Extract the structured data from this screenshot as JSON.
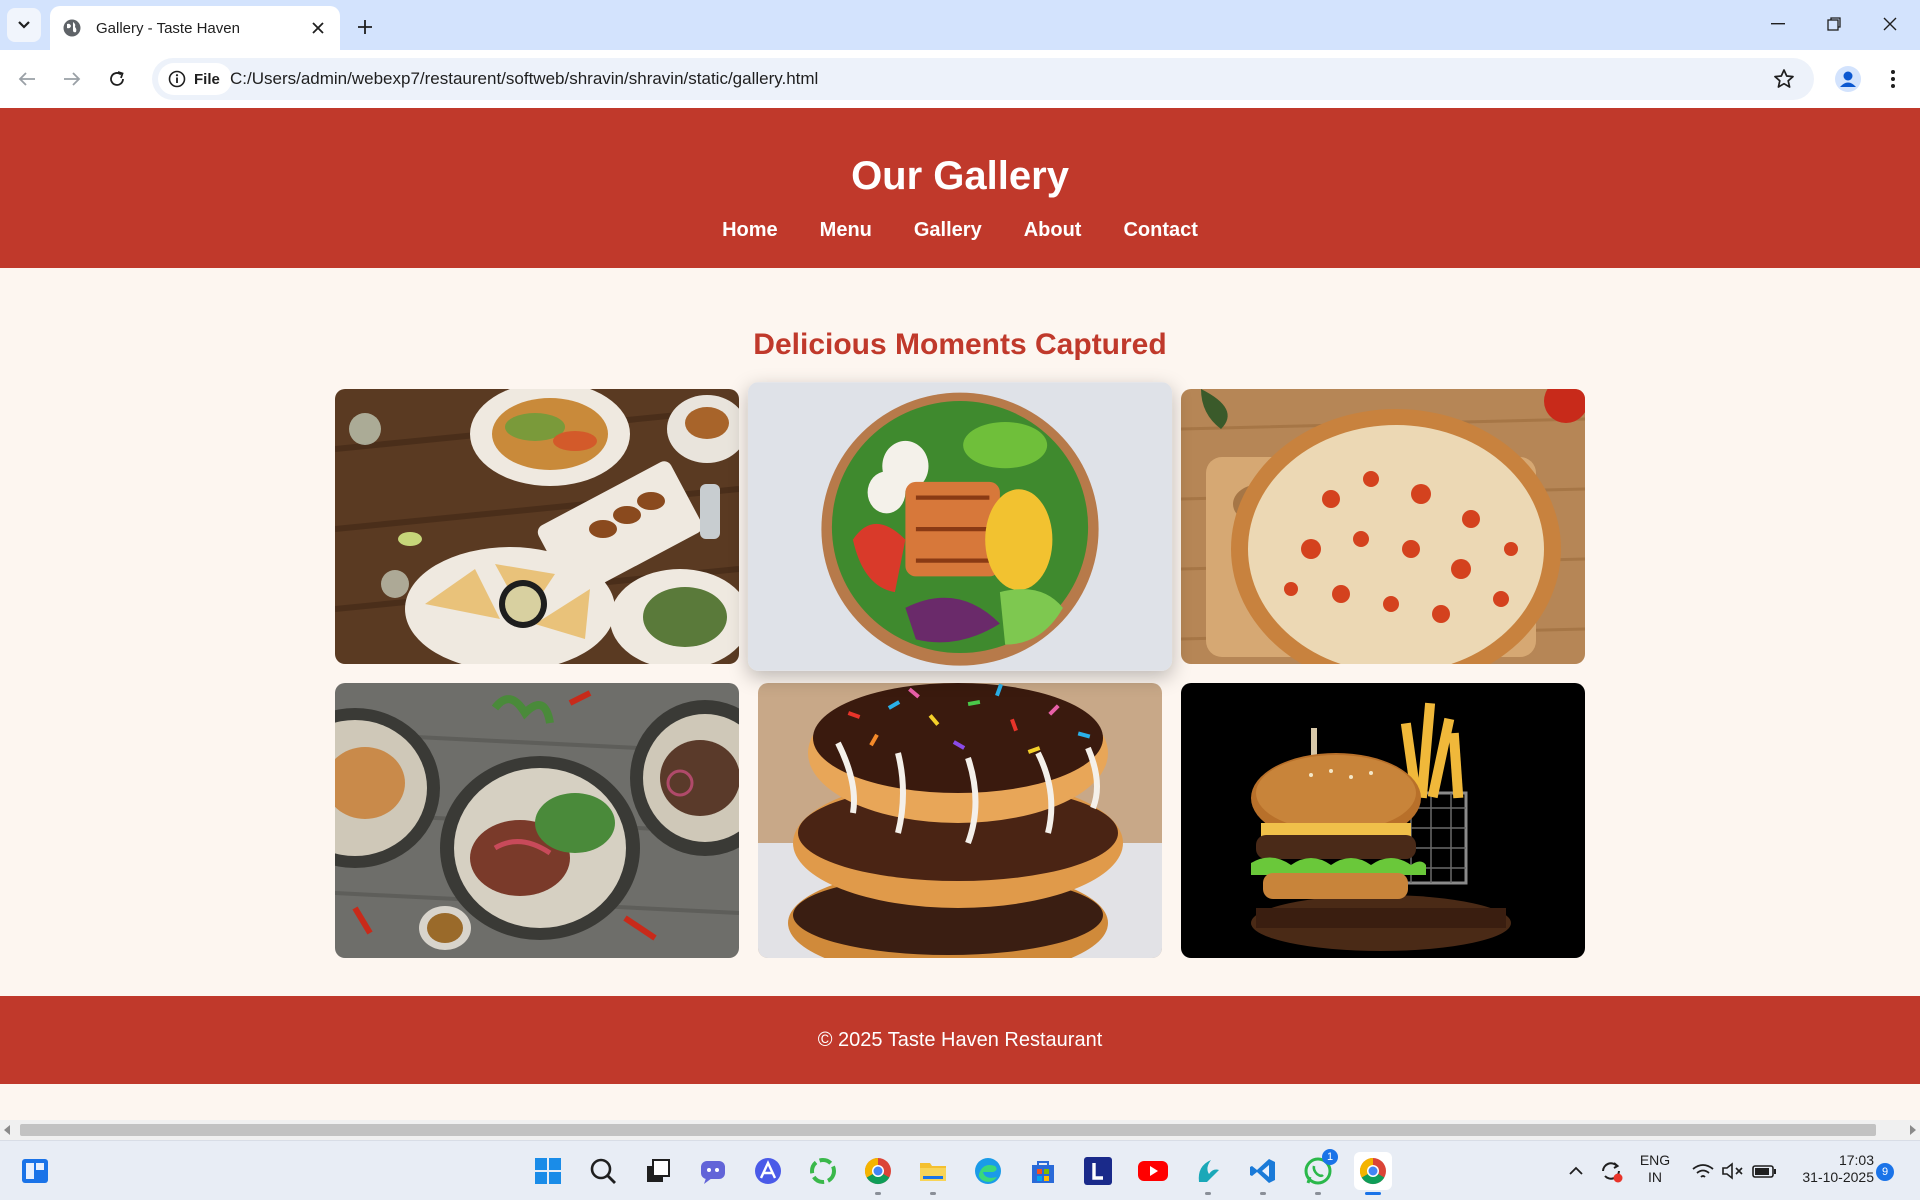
{
  "browser": {
    "tab_title": "Gallery - Taste Haven",
    "chip_label": "File",
    "url": "C:/Users/admin/webexp7/restaurent/softweb/shravin/shravin/static/gallery.html"
  },
  "site": {
    "title": "Our Gallery",
    "nav": [
      "Home",
      "Menu",
      "Gallery",
      "About",
      "Contact"
    ],
    "section_title": "Delicious Moments Captured",
    "footer": "© 2025 Taste Haven Restaurant",
    "brand_color": "#c0392b",
    "page_bg": "#fdf6f0"
  },
  "gallery": {
    "photos": [
      {
        "subject": "table-spread-icon"
      },
      {
        "subject": "salad-bowl-icon"
      },
      {
        "subject": "pizza-icon"
      },
      {
        "subject": "grilled-meat-plates-icon"
      },
      {
        "subject": "donuts-icon"
      },
      {
        "subject": "burger-fries-icon"
      }
    ]
  },
  "taskbar": {
    "lang_line1": "ENG",
    "lang_line2": "IN",
    "time": "17:03",
    "date": "31-10-2025",
    "notification_count": "9",
    "whatsapp_badge": "1"
  }
}
